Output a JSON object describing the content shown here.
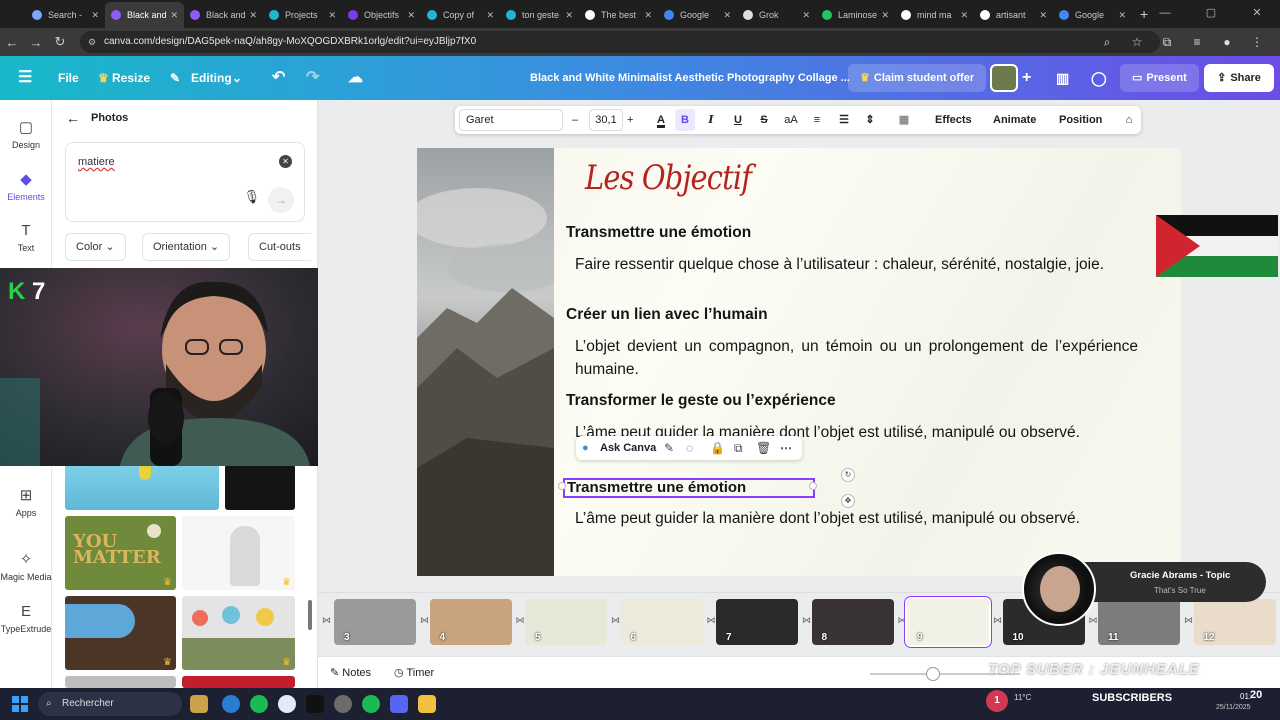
{
  "browser": {
    "tabs": [
      {
        "label": "Search -",
        "color": "#7aa7ff",
        "active": false
      },
      {
        "label": "Black and",
        "color": "#8b5cf6",
        "active": true
      },
      {
        "label": "Black and",
        "color": "#8b5cf6",
        "active": false
      },
      {
        "label": "Projects",
        "color": "#22b5d0",
        "active": false
      },
      {
        "label": "Objectifs",
        "color": "#7c3aed",
        "active": false
      },
      {
        "label": "Copy of",
        "color": "#22b5d0",
        "active": false
      },
      {
        "label": "ton geste",
        "color": "#22b5d0",
        "active": false
      },
      {
        "label": "The best",
        "color": "#ffffff",
        "active": false
      },
      {
        "label": "Google",
        "color": "#4285f4",
        "active": false
      },
      {
        "label": "Grok",
        "color": "#dddddd",
        "active": false
      },
      {
        "label": "Laminose",
        "color": "#22c55e",
        "active": false
      },
      {
        "label": "mind ma",
        "color": "#ffffff",
        "active": false
      },
      {
        "label": "artisant",
        "color": "#ffffff",
        "active": false
      },
      {
        "label": "Google",
        "color": "#4285f4",
        "active": false
      }
    ],
    "new_tab": "+",
    "url": "canva.com/design/DAG5pek-naQ/ah8gy-MoXQOGDXBRk1orlg/edit?ui=eyJBljp7fX0"
  },
  "header": {
    "menu_icon": "☰",
    "file": "File",
    "resize": "Resize",
    "editing": "Editing",
    "doc_title": "Black and White Minimalist Aesthetic Photography Collage ...",
    "claim": "Claim student offer",
    "present": "Present",
    "share": "Share"
  },
  "rail": [
    {
      "label": "Design",
      "icon": "▢",
      "active": false
    },
    {
      "label": "Elements",
      "icon": "◆",
      "active": true
    },
    {
      "label": "Text",
      "icon": "T",
      "active": false
    },
    {
      "label": "Apps",
      "icon": "⊞",
      "active": false
    },
    {
      "label": "Magic Media",
      "icon": "✧",
      "active": false
    },
    {
      "label": "TypeExtrude",
      "icon": "E",
      "active": false
    }
  ],
  "panel": {
    "back": "←",
    "title": "Photos",
    "search_value": "matiere",
    "filters": [
      "Color",
      "Orientation",
      "Cut-outs"
    ]
  },
  "webcam_logo": {
    "k": "K",
    "num": "7"
  },
  "toolbar": {
    "font": "Garet",
    "minus": "–",
    "size": "30,1",
    "plus": "+",
    "effects": "Effects",
    "animate": "Animate",
    "position": "Position"
  },
  "slide": {
    "title": "Les Objectif",
    "sections": [
      {
        "heading": "Transmettre une émotion",
        "body": "Faire ressentir quelque chose à l’utilisateur : chaleur, sérénité, nostalgie, joie."
      },
      {
        "heading": "Créer un lien avec l’humain",
        "body": "L’objet devient un compagnon, un témoin ou un prolongement de l’expérience humaine."
      },
      {
        "heading": "Transformer le geste ou l’expérience",
        "body": "L’âme peut guider la manière dont l’objet est utilisé, manipulé ou observé."
      }
    ],
    "selected_heading": "Transmettre une émotion",
    "selected_body": "L’âme peut guider la manière dont l’objet est utilisé, manipulé ou observé."
  },
  "ask_bar": {
    "label": "Ask Canva"
  },
  "filmstrip": {
    "pages": [
      {
        "num": "3",
        "bg": "#9a9a9a"
      },
      {
        "num": "4",
        "bg": "#c9a27e"
      },
      {
        "num": "5",
        "bg": "#e8e8d8"
      },
      {
        "num": "6",
        "bg": "#eceadb"
      },
      {
        "num": "7",
        "bg": "#2a2a2a"
      },
      {
        "num": "8",
        "bg": "#3a3333"
      },
      {
        "num": "9",
        "bg": "#f1f1e6"
      },
      {
        "num": "10",
        "bg": "#2b2b2b"
      },
      {
        "num": "11",
        "bg": "#7d7d7d"
      },
      {
        "num": "12",
        "bg": "#e9dccb"
      }
    ],
    "selected_page": "9"
  },
  "bottom": {
    "notes": "Notes",
    "timer": "Timer",
    "overlay_text": "TOP SUBER : JEUNHEALE"
  },
  "music": {
    "title": "Gracie Abrams - Topic",
    "subtitle": "That's So True"
  },
  "taskbar": {
    "search_placeholder": "Rechercher",
    "subscribers": "SUBSCRIBERS",
    "sub_count": "20",
    "temp": "11°C",
    "time": "01:",
    "date": "25/11/2025",
    "badge": "1"
  }
}
